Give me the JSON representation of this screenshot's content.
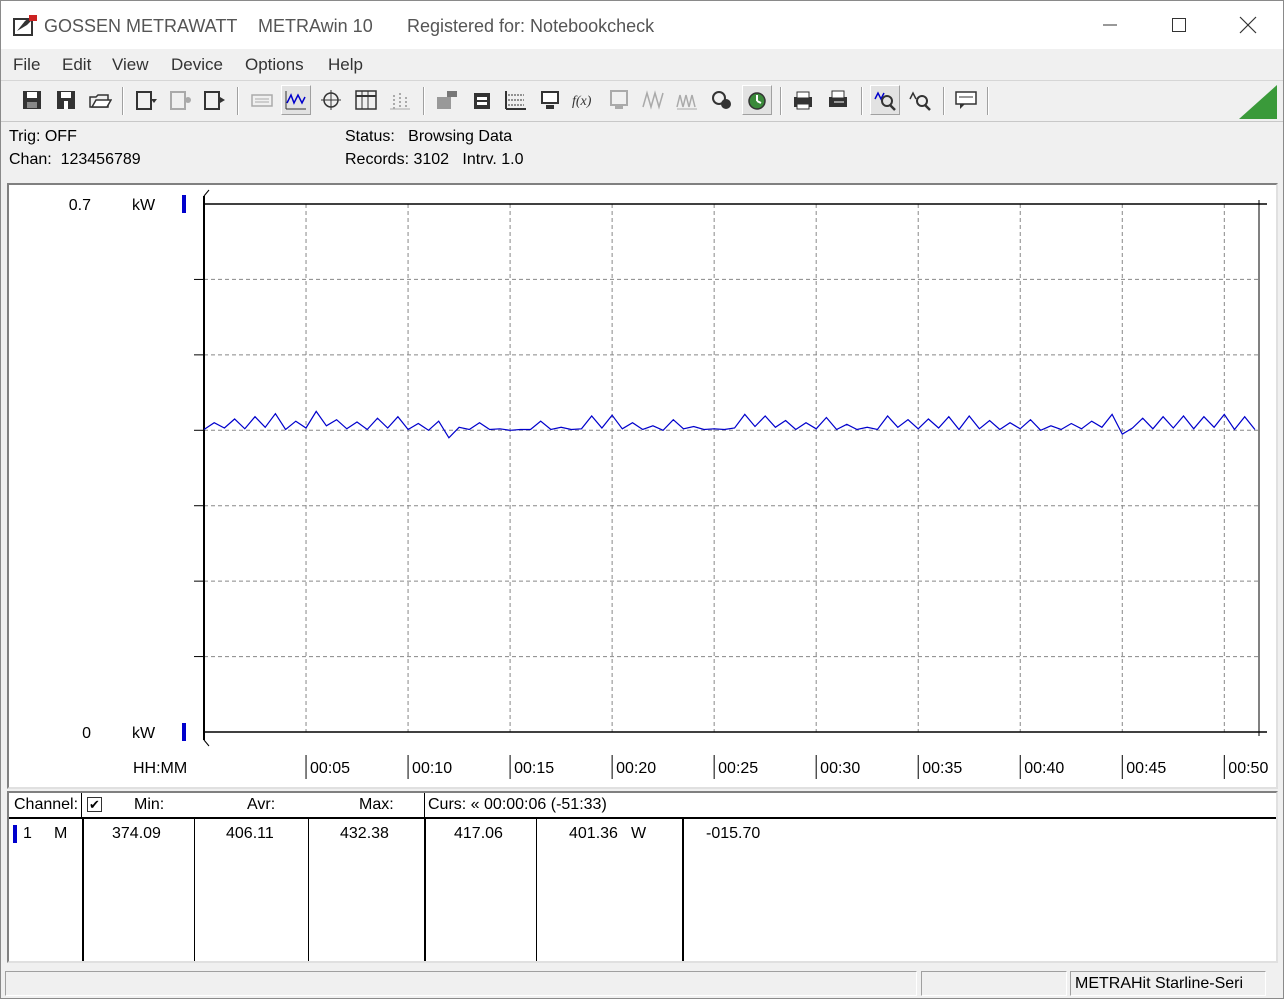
{
  "titlebar": {
    "brand": "GOSSEN METRAWATT",
    "app": "METRAwin 10",
    "registered": "Registered for: Notebookcheck"
  },
  "menu": [
    "File",
    "Edit",
    "View",
    "Device",
    "Options",
    "Help"
  ],
  "toolbar": {
    "icons": [
      "save-disk-icon",
      "save-as-disk-icon",
      "open-folder-icon",
      "device-read-icon",
      "device-config-icon",
      "device-send-icon",
      "keyboard-icon",
      "waveform-view-icon",
      "crosshair-cursor-icon",
      "table-view-icon",
      "bar-view-icon",
      "export-icon",
      "import-icon",
      "grid-settings-icon",
      "monitor-icon",
      "formula-icon",
      "display-icon",
      "signal-icon",
      "multi-signal-icon",
      "tools-icon",
      "timer-icon",
      "printer-setup-icon",
      "print-icon",
      "zoom-in-icon",
      "zoom-out-icon",
      "comment-icon"
    ]
  },
  "info": {
    "trig": "Trig: OFF",
    "chan": "Chan:  123456789",
    "status": "Status:   Browsing Data",
    "records": "Records: 3102   Intrv. 1.0"
  },
  "chart_data": {
    "type": "line",
    "y_top_label": "0.7",
    "y_bottom_label": "0",
    "y_unit": "kW",
    "x_axis_label": "HH:MM",
    "x_ticks": [
      "00:05",
      "00:10",
      "00:15",
      "00:20",
      "00:25",
      "00:30",
      "00:35",
      "00:40",
      "00:45",
      "00:50"
    ],
    "ylim": [
      0,
      0.7
    ],
    "xlim_minutes": [
      0,
      51.7
    ],
    "grid": true,
    "series": [
      {
        "color": "#0000cc",
        "baseline_kw": 0.401,
        "x_minutes": [
          0,
          0.5,
          1,
          1.5,
          2,
          2.5,
          3,
          3.5,
          4,
          4.5,
          5,
          5.5,
          6,
          6.5,
          7,
          7.5,
          8,
          8.5,
          9,
          9.5,
          10,
          10.5,
          11,
          11.5,
          12,
          12.5,
          13,
          13.5,
          14,
          14.5,
          15,
          15.5,
          16,
          16.5,
          17,
          17.5,
          18,
          18.5,
          19,
          19.5,
          20,
          20.5,
          21,
          21.5,
          22,
          22.5,
          23,
          23.5,
          24,
          24.5,
          25,
          25.5,
          26,
          26.5,
          27,
          27.5,
          28,
          28.5,
          29,
          29.5,
          30,
          30.5,
          31,
          31.5,
          32,
          32.5,
          33,
          33.5,
          34,
          34.5,
          35,
          35.5,
          36,
          36.5,
          37,
          37.5,
          38,
          38.5,
          39,
          39.5,
          40,
          40.5,
          41,
          41.5,
          42,
          42.5,
          43,
          43.5,
          44,
          44.5,
          45,
          45.5,
          46,
          46.5,
          47,
          47.5,
          48,
          48.5,
          49,
          49.5,
          50,
          50.5,
          51,
          51.5
        ],
        "values_kw": [
          0.401,
          0.41,
          0.403,
          0.415,
          0.402,
          0.418,
          0.404,
          0.422,
          0.401,
          0.412,
          0.403,
          0.425,
          0.406,
          0.414,
          0.402,
          0.411,
          0.401,
          0.416,
          0.403,
          0.418,
          0.401,
          0.409,
          0.4,
          0.412,
          0.39,
          0.404,
          0.401,
          0.41,
          0.401,
          0.402,
          0.4,
          0.401,
          0.401,
          0.412,
          0.401,
          0.404,
          0.401,
          0.402,
          0.419,
          0.403,
          0.42,
          0.402,
          0.41,
          0.401,
          0.406,
          0.4,
          0.414,
          0.402,
          0.405,
          0.401,
          0.402,
          0.401,
          0.403,
          0.421,
          0.405,
          0.419,
          0.404,
          0.413,
          0.401,
          0.41,
          0.402,
          0.417,
          0.401,
          0.408,
          0.401,
          0.404,
          0.401,
          0.419,
          0.404,
          0.414,
          0.402,
          0.415,
          0.403,
          0.418,
          0.401,
          0.419,
          0.402,
          0.413,
          0.401,
          0.41,
          0.402,
          0.414,
          0.4,
          0.406,
          0.401,
          0.409,
          0.402,
          0.412,
          0.404,
          0.421,
          0.395,
          0.403,
          0.416,
          0.402,
          0.418,
          0.403,
          0.419,
          0.402,
          0.418,
          0.404,
          0.421,
          0.401,
          0.418,
          0.401
        ]
      }
    ]
  },
  "table": {
    "headers": {
      "channel": "Channel:",
      "min": "Min:",
      "avr": "Avr:",
      "max": "Max:",
      "curs": "Curs: « 00:00:06 (-51:33)"
    },
    "row": {
      "channel": "1",
      "mode": "M",
      "min": "374.09",
      "avr": "406.11",
      "max": "432.38",
      "curs1": "417.06",
      "curs2": "401.36",
      "unit": "W",
      "diff": "-015.70"
    }
  },
  "statusbar": {
    "panel1": "",
    "panel2": "",
    "device": "METRAHit Starline-Seri"
  }
}
